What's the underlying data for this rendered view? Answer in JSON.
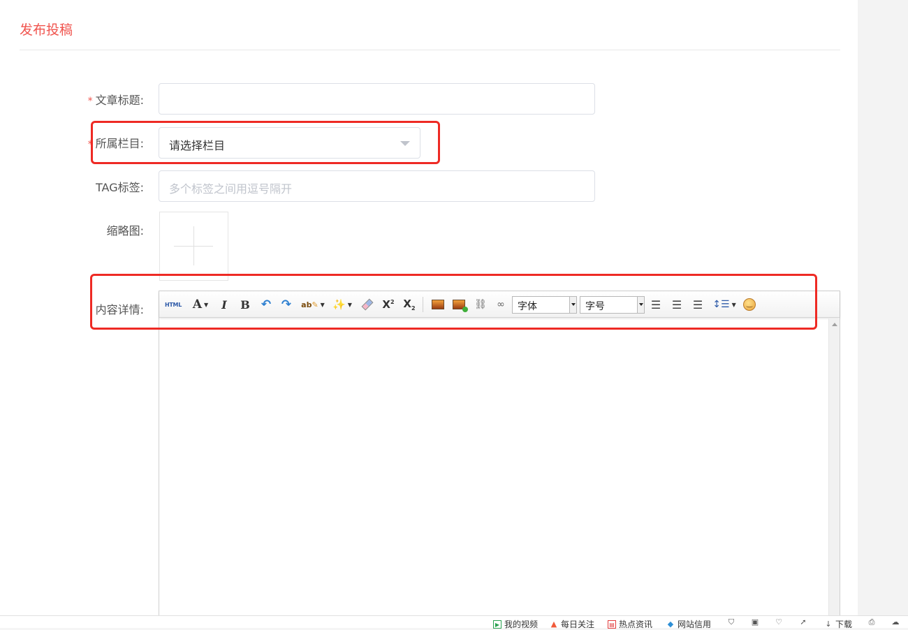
{
  "header": {
    "title": "发布投稿"
  },
  "form": {
    "title_field": {
      "label": "文章标题:",
      "required_mark": "*",
      "value": ""
    },
    "category_field": {
      "label": "所属栏目:",
      "required_mark": "*",
      "selected": "请选择栏目"
    },
    "tag_field": {
      "label": "TAG标签:",
      "placeholder": "多个标签之间用逗号隔开"
    },
    "thumbnail_field": {
      "label": "缩略图:"
    },
    "content_field": {
      "label": "内容详情:"
    }
  },
  "editor": {
    "toolbar": {
      "html_label": "HTML",
      "font_label": "字体",
      "size_label": "字号",
      "icons": [
        "source-html",
        "font-color",
        "italic",
        "bold",
        "undo",
        "redo",
        "spellcheck",
        "magic-format",
        "eraser",
        "superscript",
        "subscript",
        "insert-image",
        "insert-image-multi",
        "unlink",
        "link",
        "align-left",
        "align-center",
        "align-right",
        "line-height",
        "emoticon"
      ]
    }
  },
  "statusbar": {
    "items": [
      "我的视频",
      "每日关注",
      "热点资讯",
      "网站信用",
      "下载"
    ]
  },
  "colors": {
    "accent": "#f0554f",
    "annotation": "#ee2a24"
  }
}
